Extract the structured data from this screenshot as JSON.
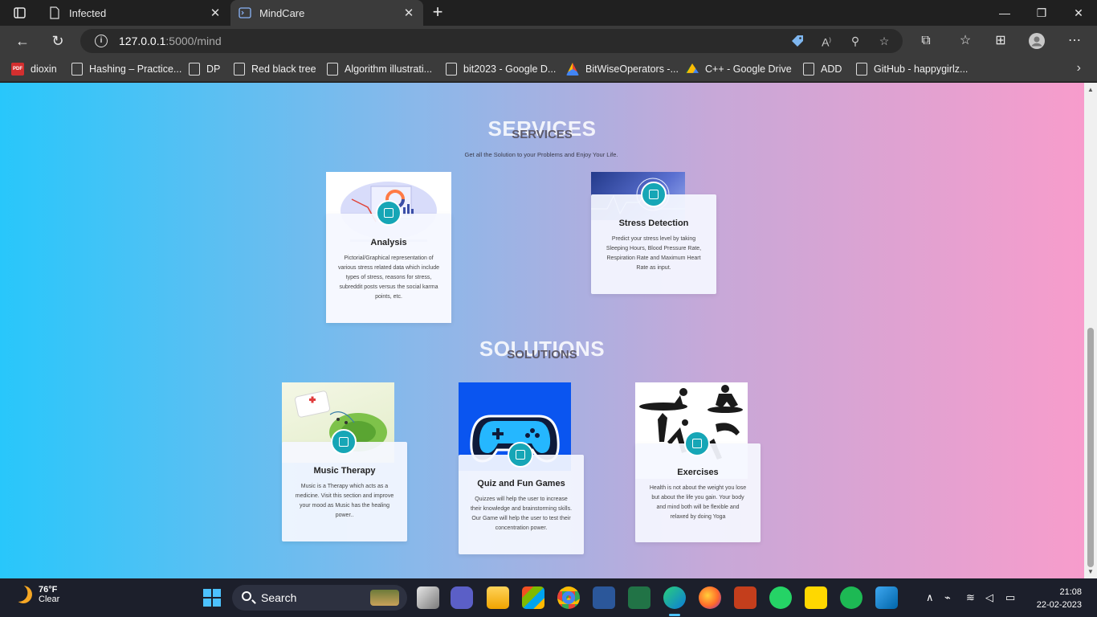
{
  "browser": {
    "tabs": [
      {
        "title": "Infected",
        "icon": "page-icon"
      },
      {
        "title": "MindCare",
        "icon": "terminal-icon"
      }
    ],
    "url_host": "127.0.0.1",
    "url_path": ":5000/mind",
    "bookmarks": [
      {
        "label": "dioxin",
        "icon": "pdf-icon"
      },
      {
        "label": "Hashing – Practice...",
        "icon": "page-icon"
      },
      {
        "label": "DP",
        "icon": "page-icon"
      },
      {
        "label": "Red black tree",
        "icon": "page-icon"
      },
      {
        "label": "Algorithm illustrati...",
        "icon": "page-icon"
      },
      {
        "label": "bit2023 - Google D...",
        "icon": "page-icon"
      },
      {
        "label": "BitWiseOperators -...",
        "icon": "google-drive-icon"
      },
      {
        "label": "C++ - Google Drive",
        "icon": "google-drive-icon"
      },
      {
        "label": "ADD",
        "icon": "page-icon"
      },
      {
        "label": "GitHub - happygirlz...",
        "icon": "page-icon"
      }
    ]
  },
  "page": {
    "services": {
      "title_big": "SERVICES",
      "title_small": "SERVICES",
      "subtitle": "Get all the Solution to your Problems and Enjoy Your Life.",
      "cards": [
        {
          "title": "Analysis",
          "description": "Pictorial/Graphical representation of various stress related data which include types of stress, reasons for stress, subreddit posts versus the social karma points, etc."
        },
        {
          "title": "Stress Detection",
          "description": "Predict your stress level by taking Sleeping Hours, Blood Pressure Rate, Respiration Rate and Maximum Heart Rate as input."
        }
      ]
    },
    "solutions": {
      "title_big": "SOLUTIONS",
      "title_small": "SOLUTIONS",
      "cards": [
        {
          "title": "Music Therapy",
          "description": "Music is a Therapy which acts as a medicine. Visit this section and improve your mood as Music has the healing power.."
        },
        {
          "title": "Quiz and Fun Games",
          "description": "Quizzes will help the user to increase their knowledge and brainstorming skills. Our Game will help the user to test their concentration power."
        },
        {
          "title": "Exercises",
          "description": "Health is not about the weight you lose but about the life you gain. Your body and mind both will be flexible and relaxed by doing Yoga"
        }
      ]
    }
  },
  "taskbar": {
    "weather_temp": "76°F",
    "weather_cond": "Clear",
    "search_label": "Search",
    "time": "21:08",
    "date": "22-02-2023"
  }
}
